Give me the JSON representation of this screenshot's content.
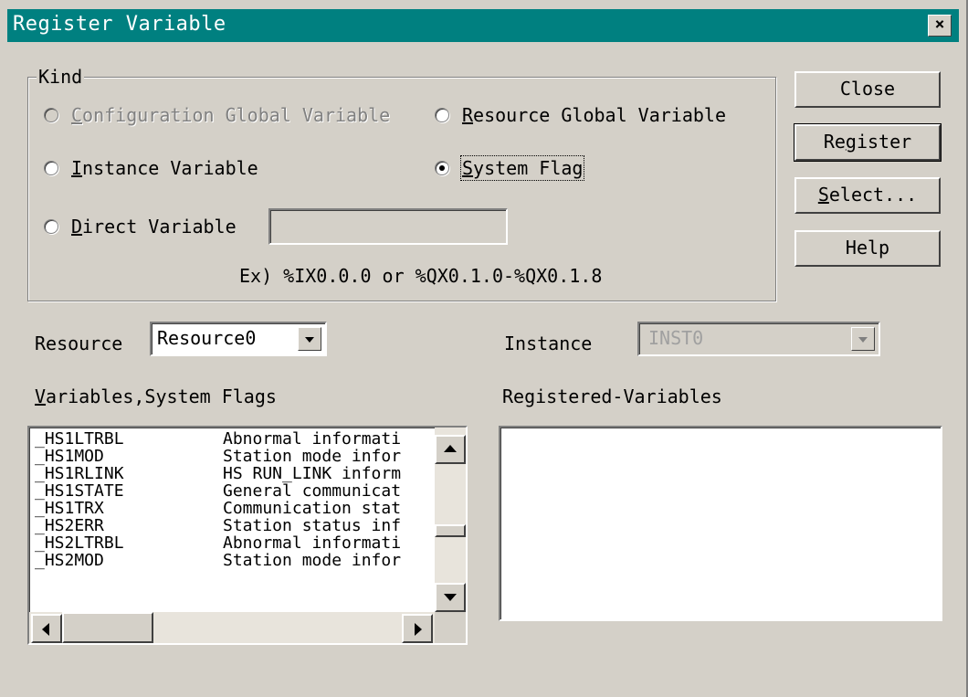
{
  "window": {
    "title": "Register Variable",
    "close_glyph": "×"
  },
  "kind": {
    "legend": "Kind",
    "config_global": {
      "prefix": "",
      "accel": "C",
      "rest": "onfiguration Global Variable",
      "enabled": false,
      "checked": false
    },
    "resource_global": {
      "prefix": "",
      "accel": "R",
      "rest": "esource Global Variable",
      "enabled": true,
      "checked": false
    },
    "instance": {
      "prefix": "",
      "accel": "I",
      "rest": "nstance Variable",
      "enabled": true,
      "checked": false
    },
    "system_flag": {
      "prefix": "",
      "accel": "S",
      "rest": "ystem Flag",
      "enabled": true,
      "checked": true
    },
    "direct": {
      "prefix": "",
      "accel": "D",
      "rest": "irect Variable",
      "enabled": true,
      "checked": false,
      "value": ""
    },
    "example": "Ex) %IX0.0.0 or %QX0.1.0-%QX0.1.8"
  },
  "buttons": {
    "close": "Close",
    "register_pre": "Re",
    "register_accel": "g",
    "register_post": "ister",
    "select_accel": "S",
    "select_post": "elect...",
    "help": "Help"
  },
  "resource": {
    "label": "Resource",
    "value": "Resource0"
  },
  "instance_select": {
    "label": "Instance",
    "value": "INST0",
    "enabled": false
  },
  "variables": {
    "label_accel": "V",
    "label_rest": "ariables,System Flags",
    "rows": [
      {
        "name": "_HS1LTRBL",
        "desc": "Abnormal informati"
      },
      {
        "name": "_HS1MOD",
        "desc": "Station mode infor"
      },
      {
        "name": "_HS1RLINK",
        "desc": "HS RUN_LINK inform"
      },
      {
        "name": "_HS1STATE",
        "desc": "General communicat"
      },
      {
        "name": "_HS1TRX",
        "desc": "Communication stat"
      },
      {
        "name": "_HS2ERR",
        "desc": "Station status inf"
      },
      {
        "name": "_HS2LTRBL",
        "desc": "Abnormal informati"
      },
      {
        "name": "_HS2MOD",
        "desc": "Station mode infor"
      }
    ]
  },
  "registered": {
    "label": "Registered-Variables",
    "items": []
  },
  "colors": {
    "titlebar": "#008080",
    "face": "#d4d0c8",
    "shadow": "#808080"
  }
}
